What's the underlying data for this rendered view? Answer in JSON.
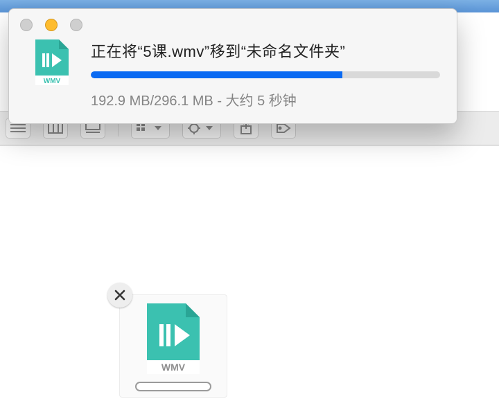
{
  "sheet": {
    "title": "正在将“5课.wmv”移到“未命名文件夹”",
    "status": "192.9 MB/296.1 MB - 大约 5 秒钟",
    "progress_percent": 72,
    "file_ext_label": "WMV"
  },
  "drag": {
    "file_ext_label": "WMV"
  },
  "colors": {
    "accent": "#0a6af2",
    "icon_teal": "#3bc1b0"
  }
}
